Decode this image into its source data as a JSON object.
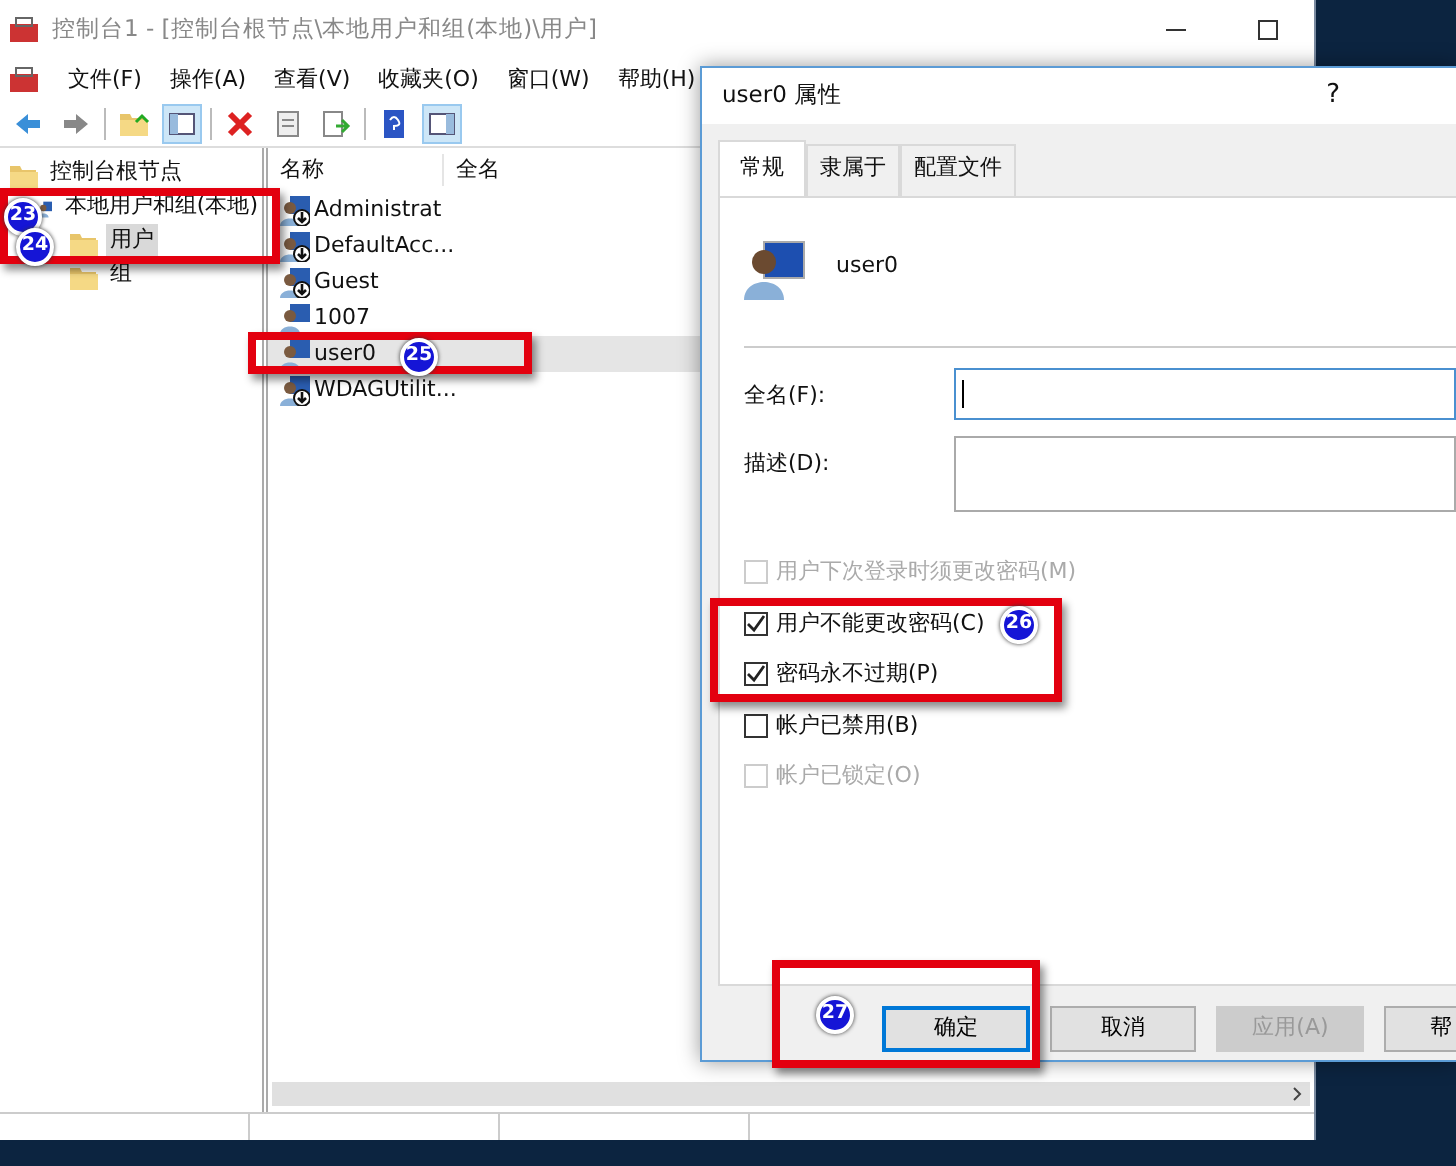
{
  "window": {
    "title": "控制台1 - [控制台根节点\\本地用户和组(本地)\\用户]"
  },
  "menu": [
    "文件(F)",
    "操作(A)",
    "查看(V)",
    "收藏夹(O)",
    "窗口(W)",
    "帮助(H)"
  ],
  "tree": [
    {
      "label": "控制台根节点",
      "selected": false,
      "children": [
        {
          "label": "本地用户和组(本地)",
          "selected": false,
          "children": [
            {
              "label": "用户",
              "selected": true
            },
            {
              "label": "组",
              "selected": false
            }
          ]
        }
      ]
    }
  ],
  "list": {
    "columns": [
      "名称",
      "全名"
    ],
    "rows": [
      {
        "name": "Administrat",
        "selected": false,
        "disabled": true
      },
      {
        "name": "DefaultAcc...",
        "selected": false,
        "disabled": true
      },
      {
        "name": "Guest",
        "selected": false,
        "disabled": true
      },
      {
        "name": "1007",
        "selected": false,
        "disabled": false
      },
      {
        "name": "user0",
        "selected": true,
        "disabled": false
      },
      {
        "name": "WDAGUtilit...",
        "selected": false,
        "disabled": true
      }
    ]
  },
  "dialog": {
    "title": "user0 属性",
    "help": "?",
    "tabs": [
      {
        "label": "常规",
        "selected": true
      },
      {
        "label": "隶属于",
        "selected": false
      },
      {
        "label": "配置文件",
        "selected": false
      }
    ],
    "user_name": "user0",
    "fields": [
      {
        "label": "全名(F):",
        "focused": true
      },
      {
        "label": "描述(D):",
        "focused": false
      }
    ],
    "checkboxes": [
      {
        "label": "用户下次登录时须更改密码(M)",
        "checked": false,
        "disabled": true
      },
      {
        "label": "用户不能更改密码(C)",
        "checked": true,
        "disabled": false
      },
      {
        "label": "密码永不过期(P)",
        "checked": true,
        "disabled": false
      },
      {
        "label": "帐户已禁用(B)",
        "checked": false,
        "disabled": false
      },
      {
        "label": "帐户已锁定(O)",
        "checked": false,
        "disabled": true
      }
    ],
    "buttons": [
      {
        "label": "确定",
        "disabled": false,
        "default": true
      },
      {
        "label": "取消",
        "disabled": false,
        "default": false
      },
      {
        "label": "应用(A)",
        "disabled": true,
        "default": false
      },
      {
        "label": "帮",
        "disabled": false,
        "default": false
      }
    ]
  },
  "annotations": [
    "23",
    "24",
    "25",
    "26",
    "27"
  ]
}
